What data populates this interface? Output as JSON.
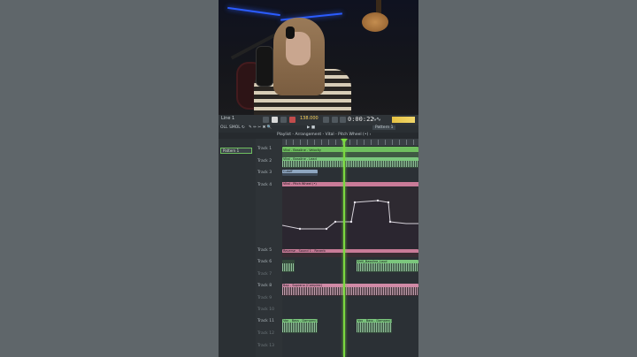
{
  "toolbar": {
    "time": "0:00:22",
    "bpm": "138.000",
    "pattern_selector": "Pattern 1",
    "left_label": "Line 1"
  },
  "tools": {
    "snap_label": "OLL SMOL",
    "playlist_title": "Playlist - Arrangement - Vital - Pitch Wheel (•) ›"
  },
  "sidebar": {
    "pattern_item": "Pattern 1"
  },
  "tracks": [
    {
      "label": "Track 1",
      "dim": false
    },
    {
      "label": "Track 2",
      "dim": false
    },
    {
      "label": "Track 3",
      "dim": false
    },
    {
      "label": "Track 4",
      "dim": false
    },
    {
      "label": "Track 5",
      "dim": false
    },
    {
      "label": "Track 6",
      "dim": false
    },
    {
      "label": "Track 7",
      "dim": true
    },
    {
      "label": "Track 8",
      "dim": false
    },
    {
      "label": "Track 9",
      "dim": true
    },
    {
      "label": "Track 10",
      "dim": true
    },
    {
      "label": "Track 11",
      "dim": false
    },
    {
      "label": "Track 12",
      "dim": true
    },
    {
      "label": "Track 13",
      "dim": true
    }
  ],
  "clips": {
    "t1": "Vital - Bassline - Velocity",
    "t2a": "Vital - Bassline - Lead",
    "t3": "Cutoff",
    "t4": "Vital - Pitch Wheel (•)",
    "t5": "Reverse - Sound 1 - Reverb",
    "t6": "Drill_Bassline_Loud",
    "t8": "Bap - Soprano (Complex)",
    "t11": "Vox - Bass - Dampen(L)"
  },
  "colors": {
    "accent_green": "#7ad840",
    "clip_green": "#6fbf5f",
    "clip_pink": "#c97b98",
    "led_blue": "#2b5cff"
  }
}
